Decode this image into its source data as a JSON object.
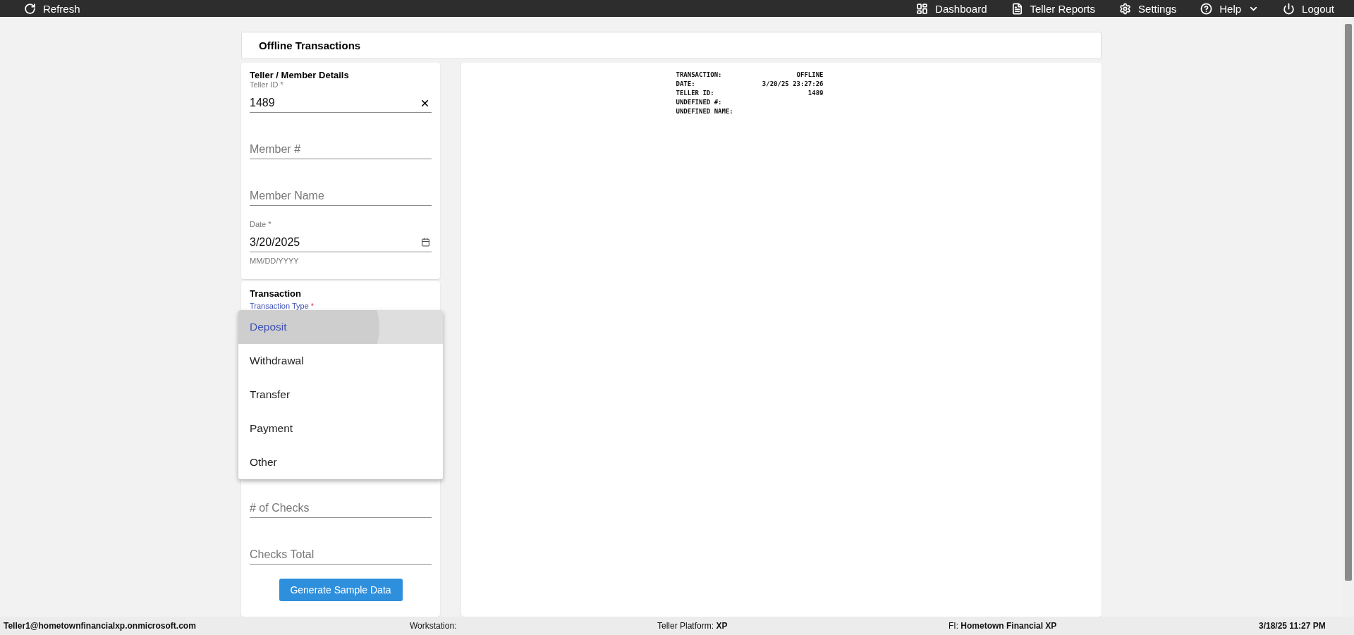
{
  "topbar": {
    "left": [
      {
        "label": "Refresh"
      }
    ],
    "right": [
      {
        "label": "Dashboard"
      },
      {
        "label": "Teller Reports"
      },
      {
        "label": "Settings"
      },
      {
        "label": "Help",
        "dropdown": true
      },
      {
        "label": "Logout"
      }
    ]
  },
  "page_title": "Offline Transactions",
  "details": {
    "title": "Teller / Member Details",
    "fields": [
      {
        "kind": "text",
        "label": "Teller ID *",
        "value": "1489",
        "clearable": true
      },
      {
        "kind": "text",
        "placeholder": "Member #"
      },
      {
        "kind": "text",
        "placeholder": "Member Name"
      },
      {
        "kind": "date",
        "label": "Date *",
        "value": "3/20/2025",
        "helper": "MM/DD/YYYY"
      }
    ]
  },
  "transaction": {
    "title": "Transaction",
    "type_label": "Transaction Type",
    "required_mark": "*",
    "menu": [
      {
        "label": "Deposit",
        "selected": true
      },
      {
        "label": "Withdrawal",
        "selected": false
      },
      {
        "label": "Transfer",
        "selected": false
      },
      {
        "label": "Payment",
        "selected": false
      },
      {
        "label": "Other",
        "selected": false
      }
    ],
    "fields": [
      {
        "kind": "text",
        "placeholder": "# of Checks"
      },
      {
        "kind": "text",
        "placeholder": "Checks Total"
      }
    ],
    "button": "Generate Sample Data"
  },
  "receipt": [
    {
      "label": "TRANSACTION:",
      "value": "OFFLINE"
    },
    {
      "label": "DATE:",
      "value": "3/20/25 23:27:26"
    },
    {
      "label": "TELLER ID:",
      "value": "1489"
    },
    {
      "label": "UNDEFINED #:"
    },
    {
      "label": "UNDEFINED NAME:"
    }
  ],
  "status_bar": {
    "user": "Teller1@hometownfinancialxp.onmicrosoft.com",
    "items": [
      {
        "label": "Workstation:"
      },
      {
        "label": "Teller Platform:",
        "value": "XP"
      },
      {
        "label": "FI:",
        "value": "Hometown Financial XP"
      }
    ],
    "datetime": "3/18/25 11:27 PM"
  }
}
